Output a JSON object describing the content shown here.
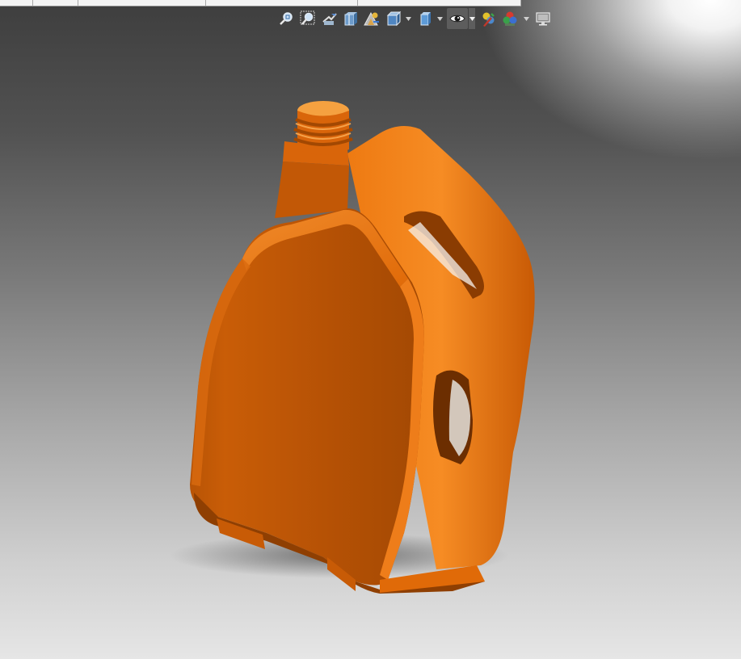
{
  "window": {
    "tabs": [
      "",
      "",
      "",
      "",
      ""
    ]
  },
  "toolbar": {
    "buttons": [
      {
        "icon": "zoom-to-fit-icon",
        "dropdown": false
      },
      {
        "icon": "zoom-to-area-icon",
        "dropdown": false
      },
      {
        "icon": "previous-view-icon",
        "dropdown": false
      },
      {
        "icon": "section-view-icon",
        "dropdown": false
      },
      {
        "icon": "dynamic-annotation-views-icon",
        "dropdown": false
      },
      {
        "icon": "view-orientation-icon",
        "dropdown": true
      },
      {
        "icon": "display-style-icon",
        "dropdown": true
      },
      {
        "icon": "hide-show-items-icon",
        "dropdown": true,
        "active": true
      },
      {
        "icon": "edit-appearance-icon",
        "dropdown": false
      },
      {
        "icon": "apply-scene-icon",
        "dropdown": true
      },
      {
        "icon": "view-settings-icon",
        "dropdown": false
      }
    ]
  },
  "model": {
    "name": "",
    "color": "#e56d0c",
    "shadow_color": "#b25206"
  }
}
